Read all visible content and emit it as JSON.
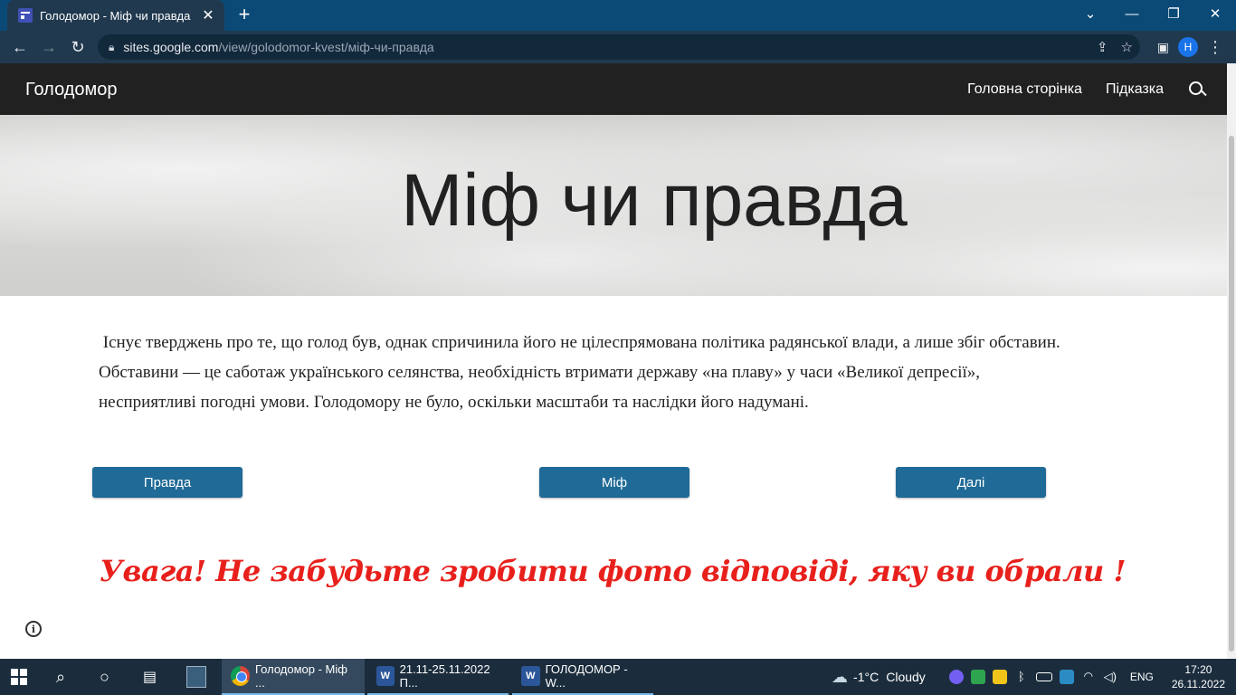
{
  "browser": {
    "tab_title": "Голодомор - Міф чи правда",
    "tab_close": "✕",
    "new_tab": "+",
    "url_host": "sites.google.com",
    "url_path": "/view/golodomor-kvest/міф-чи-правда",
    "profile_initial": "H",
    "window_controls": {
      "dropdown": "⌄",
      "minimize": "—",
      "restore": "❐",
      "close": "✕"
    }
  },
  "site": {
    "title": "Голодомор",
    "nav": [
      "Головна сторінка",
      "Підказка"
    ],
    "hero_title": "Міф чи правда",
    "body_lines": [
      " Існує тверджень про те, що голод був, однак спричинила його не цілеспрямована політика радянської влади, а лише збіг обставин.",
      "Обставини — це саботаж українського селянства, необхідність втримати державу «на плаву» у часи «Великої депресії»,",
      "несприятливі погодні умови. Голодомору не було, оскільки масштаби та наслідки його надумані."
    ],
    "buttons": {
      "truth": "Правда",
      "myth": "Міф",
      "next": "Далі"
    },
    "warning": "Увага! Не забудьте зробити фото відповіді, яку ви обрали !",
    "info_glyph": "i"
  },
  "taskbar": {
    "apps": [
      {
        "label": "Голодомор - Міф ...",
        "icon": "chrome-icon"
      },
      {
        "label": "21.11-25.11.2022 П...",
        "icon": "word-icon"
      },
      {
        "label": "ГОЛОДОМОР - W...",
        "icon": "word-icon"
      }
    ],
    "word_glyph": "W",
    "weather": {
      "temp": "-1°C",
      "condition": "Cloudy"
    },
    "language": "ENG",
    "time": "17:20",
    "date": "26.11.2022"
  },
  "colors": {
    "button": "#1f6a96",
    "warning": "#e8201c",
    "header": "#212121"
  }
}
